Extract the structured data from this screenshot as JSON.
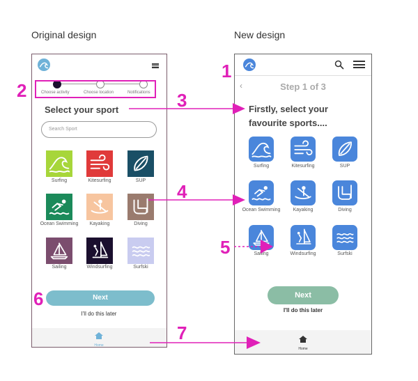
{
  "headings": {
    "original": "Original design",
    "new": "New design"
  },
  "callouts": [
    "1",
    "2",
    "3",
    "4",
    "5",
    "6",
    "7"
  ],
  "colors": {
    "accent": "#e020b8",
    "phone_border": "#7a5c6b",
    "new_tile": "#4a86db",
    "next_original": "#7dbdcc",
    "next_new": "#8bbda5"
  },
  "original": {
    "steps": [
      "Choose activity",
      "Choose location",
      "Notifications"
    ],
    "title": "Select your sport",
    "search_placeholder": "Search Sport",
    "sports": [
      {
        "label": "Surfing",
        "bg": "#a7d63a",
        "icon": "wave-icon"
      },
      {
        "label": "Kitesurfing",
        "bg": "#e03a3a",
        "icon": "wind-icon"
      },
      {
        "label": "SUP",
        "bg": "#1a4f66",
        "icon": "board-icon"
      },
      {
        "label": "Ocean Swimming",
        "bg": "#1b8a5a",
        "icon": "swimmer-icon"
      },
      {
        "label": "Kayaking",
        "bg": "#f7c59f",
        "icon": "kayak-icon"
      },
      {
        "label": "Diving",
        "bg": "#9a7b6e",
        "icon": "snorkel-icon"
      },
      {
        "label": "Sailing",
        "bg": "#7b4d6e",
        "icon": "sailboat-icon"
      },
      {
        "label": "Windsurfing",
        "bg": "#1b0f2e",
        "icon": "windsurf-icon"
      },
      {
        "label": "Surfski",
        "bg": "#c9ccf0",
        "icon": "waves-icon"
      }
    ],
    "next_label": "Next",
    "later_label": "I'll do this later",
    "home_label": "Home"
  },
  "new_design": {
    "step_text": "Step 1 of 3",
    "title_line1": "Firstly, select your",
    "title_line2": "favourite sports....",
    "sports": [
      {
        "label": "Surfing",
        "icon": "wave-icon"
      },
      {
        "label": "Kitesurfing",
        "icon": "wind-icon"
      },
      {
        "label": "SUP",
        "icon": "board-icon"
      },
      {
        "label": "Ocean Swimming",
        "icon": "swimmer-icon"
      },
      {
        "label": "Kayaking",
        "icon": "kayak-icon"
      },
      {
        "label": "Diving",
        "icon": "snorkel-icon"
      },
      {
        "label": "Sailing",
        "icon": "sailboat-icon"
      },
      {
        "label": "Windsurfing",
        "icon": "windsurf-icon"
      },
      {
        "label": "Surfski",
        "icon": "waves-icon"
      }
    ],
    "next_label": "Next",
    "later_label": "I'll do this later",
    "home_label": "Home"
  }
}
